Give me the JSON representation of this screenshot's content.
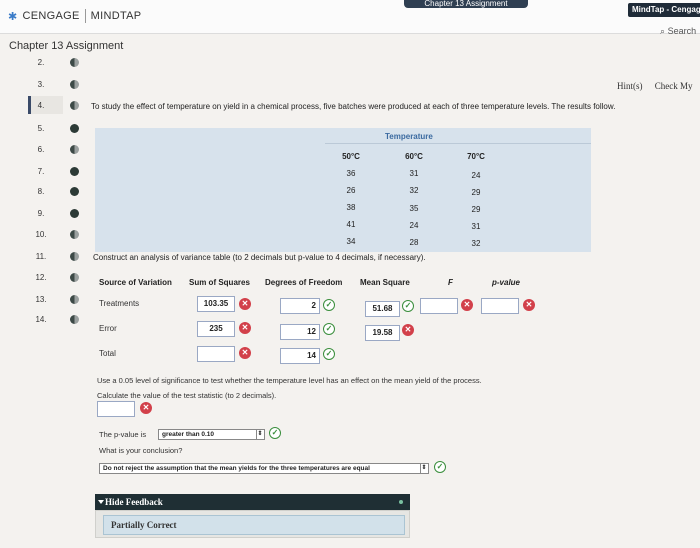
{
  "header": {
    "brand_left": "CENGAGE",
    "brand_right": "MINDTAP",
    "top_tab": "Chapter 13 Assignment",
    "app_logo": "MindTap - Cengage",
    "search_label": "Search"
  },
  "chapter_title": "Chapter 13 Assignment",
  "question_list": [
    "2.",
    "3.",
    "4.",
    "5.",
    "6.",
    "7.",
    "8.",
    "9.",
    "10.",
    "11.",
    "12.",
    "13.",
    "14."
  ],
  "hint_links": {
    "hints": "Hint(s)",
    "check": "Check My"
  },
  "prompt": "To study the effect of temperature on yield in a chemical process, five batches were produced at each of three temperature levels. The results follow.",
  "data_table": {
    "group_label": "Temperature",
    "columns": [
      "50°C",
      "60°C",
      "70°C"
    ],
    "rows": [
      [
        "36",
        "31",
        "24"
      ],
      [
        "26",
        "32",
        "29"
      ],
      [
        "38",
        "35",
        "29"
      ],
      [
        "41",
        "24",
        "31"
      ],
      [
        "34",
        "28",
        "32"
      ]
    ]
  },
  "construct_text": "Construct an analysis of variance table (to 2 decimals but p-value to 4 decimals, if necessary).",
  "anova": {
    "headers": {
      "source": "Source of Variation",
      "ss": "Sum of Squares",
      "df": "Degrees of Freedom",
      "ms": "Mean Square",
      "f": "F",
      "p": "p-value"
    },
    "treatments": {
      "label": "Treatments",
      "ss": "103.35",
      "df": "2",
      "ms": "51.68",
      "f": "",
      "p": ""
    },
    "error": {
      "label": "Error",
      "ss": "235",
      "df": "12",
      "ms": "19.58"
    },
    "total": {
      "label": "Total",
      "ss": "",
      "df": "14"
    }
  },
  "significance_text": "Use a 0.05 level of significance to test whether the temperature level has an effect on the mean yield of the process.",
  "statistic_text": "Calculate the value of the test statistic (to 2 decimals).",
  "statistic_value": "",
  "pvalue_prefix": "The p-value is",
  "pvalue_select": "greater than 0.10",
  "conclusion_q": "What is your conclusion?",
  "conclusion_select": "Do not reject the assumption that the mean yields for the three temperatures are equal",
  "feedback": {
    "toggle": "Hide Feedback",
    "result": "Partially Correct"
  }
}
